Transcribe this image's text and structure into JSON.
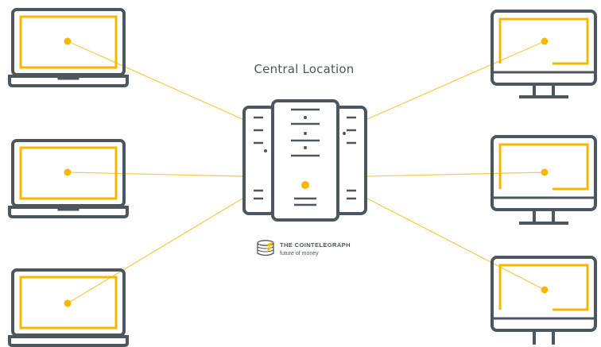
{
  "title": "Central Location",
  "brand": {
    "name": "THE COINTELEGRAPH",
    "tagline": "future of money"
  },
  "colors": {
    "accent": "#f5b700",
    "outline": "#4d565d",
    "line": "#f7c948"
  },
  "nodes": {
    "left": [
      "laptop",
      "laptop",
      "laptop"
    ],
    "right": [
      "desktop-monitor",
      "desktop-monitor",
      "desktop-monitor"
    ]
  },
  "hub_icon": "server-rack-icon"
}
